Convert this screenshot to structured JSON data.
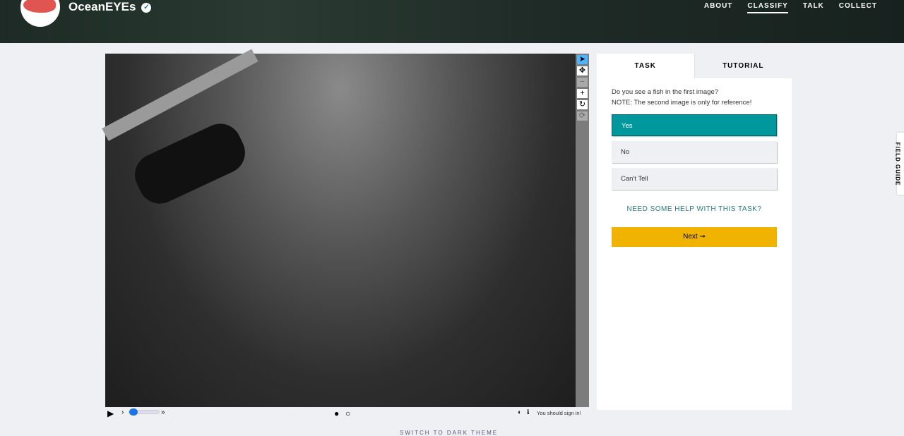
{
  "header": {
    "title": "OceanEYEs",
    "nav": [
      "ABOUT",
      "CLASSIFY",
      "TALK",
      "COLLECT"
    ],
    "active": "CLASSIFY"
  },
  "viewer": {
    "sign_in": "You should sign in!"
  },
  "panel": {
    "tabs": [
      "TASK",
      "TUTORIAL"
    ],
    "question": "Do you see a fish in the first image?",
    "note": "NOTE: The second image is only for reference!",
    "answers": [
      "Yes",
      "No",
      "Can't Tell"
    ],
    "selected": "Yes",
    "help": "NEED SOME HELP WITH THIS TASK?",
    "next": "Next ➞"
  },
  "field_guide": "FIELD GUIDE",
  "theme_toggle": "SWITCH TO DARK THEME",
  "colors": {
    "accent": "#00979d",
    "next": "#f0b400"
  }
}
